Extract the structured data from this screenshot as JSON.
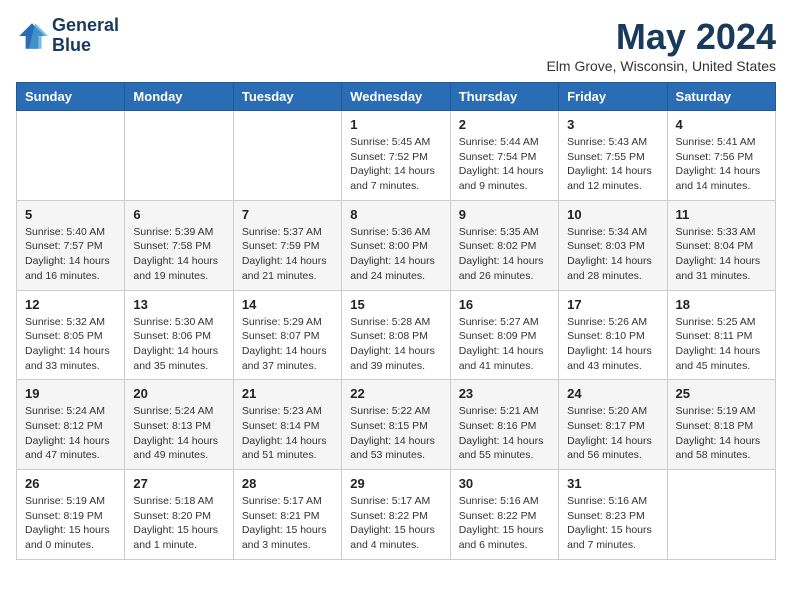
{
  "header": {
    "logo_line1": "General",
    "logo_line2": "Blue",
    "month_title": "May 2024",
    "location": "Elm Grove, Wisconsin, United States"
  },
  "days_of_week": [
    "Sunday",
    "Monday",
    "Tuesday",
    "Wednesday",
    "Thursday",
    "Friday",
    "Saturday"
  ],
  "weeks": [
    [
      {
        "day": "",
        "info": ""
      },
      {
        "day": "",
        "info": ""
      },
      {
        "day": "",
        "info": ""
      },
      {
        "day": "1",
        "info": "Sunrise: 5:45 AM\nSunset: 7:52 PM\nDaylight: 14 hours\nand 7 minutes."
      },
      {
        "day": "2",
        "info": "Sunrise: 5:44 AM\nSunset: 7:54 PM\nDaylight: 14 hours\nand 9 minutes."
      },
      {
        "day": "3",
        "info": "Sunrise: 5:43 AM\nSunset: 7:55 PM\nDaylight: 14 hours\nand 12 minutes."
      },
      {
        "day": "4",
        "info": "Sunrise: 5:41 AM\nSunset: 7:56 PM\nDaylight: 14 hours\nand 14 minutes."
      }
    ],
    [
      {
        "day": "5",
        "info": "Sunrise: 5:40 AM\nSunset: 7:57 PM\nDaylight: 14 hours\nand 16 minutes."
      },
      {
        "day": "6",
        "info": "Sunrise: 5:39 AM\nSunset: 7:58 PM\nDaylight: 14 hours\nand 19 minutes."
      },
      {
        "day": "7",
        "info": "Sunrise: 5:37 AM\nSunset: 7:59 PM\nDaylight: 14 hours\nand 21 minutes."
      },
      {
        "day": "8",
        "info": "Sunrise: 5:36 AM\nSunset: 8:00 PM\nDaylight: 14 hours\nand 24 minutes."
      },
      {
        "day": "9",
        "info": "Sunrise: 5:35 AM\nSunset: 8:02 PM\nDaylight: 14 hours\nand 26 minutes."
      },
      {
        "day": "10",
        "info": "Sunrise: 5:34 AM\nSunset: 8:03 PM\nDaylight: 14 hours\nand 28 minutes."
      },
      {
        "day": "11",
        "info": "Sunrise: 5:33 AM\nSunset: 8:04 PM\nDaylight: 14 hours\nand 31 minutes."
      }
    ],
    [
      {
        "day": "12",
        "info": "Sunrise: 5:32 AM\nSunset: 8:05 PM\nDaylight: 14 hours\nand 33 minutes."
      },
      {
        "day": "13",
        "info": "Sunrise: 5:30 AM\nSunset: 8:06 PM\nDaylight: 14 hours\nand 35 minutes."
      },
      {
        "day": "14",
        "info": "Sunrise: 5:29 AM\nSunset: 8:07 PM\nDaylight: 14 hours\nand 37 minutes."
      },
      {
        "day": "15",
        "info": "Sunrise: 5:28 AM\nSunset: 8:08 PM\nDaylight: 14 hours\nand 39 minutes."
      },
      {
        "day": "16",
        "info": "Sunrise: 5:27 AM\nSunset: 8:09 PM\nDaylight: 14 hours\nand 41 minutes."
      },
      {
        "day": "17",
        "info": "Sunrise: 5:26 AM\nSunset: 8:10 PM\nDaylight: 14 hours\nand 43 minutes."
      },
      {
        "day": "18",
        "info": "Sunrise: 5:25 AM\nSunset: 8:11 PM\nDaylight: 14 hours\nand 45 minutes."
      }
    ],
    [
      {
        "day": "19",
        "info": "Sunrise: 5:24 AM\nSunset: 8:12 PM\nDaylight: 14 hours\nand 47 minutes."
      },
      {
        "day": "20",
        "info": "Sunrise: 5:24 AM\nSunset: 8:13 PM\nDaylight: 14 hours\nand 49 minutes."
      },
      {
        "day": "21",
        "info": "Sunrise: 5:23 AM\nSunset: 8:14 PM\nDaylight: 14 hours\nand 51 minutes."
      },
      {
        "day": "22",
        "info": "Sunrise: 5:22 AM\nSunset: 8:15 PM\nDaylight: 14 hours\nand 53 minutes."
      },
      {
        "day": "23",
        "info": "Sunrise: 5:21 AM\nSunset: 8:16 PM\nDaylight: 14 hours\nand 55 minutes."
      },
      {
        "day": "24",
        "info": "Sunrise: 5:20 AM\nSunset: 8:17 PM\nDaylight: 14 hours\nand 56 minutes."
      },
      {
        "day": "25",
        "info": "Sunrise: 5:19 AM\nSunset: 8:18 PM\nDaylight: 14 hours\nand 58 minutes."
      }
    ],
    [
      {
        "day": "26",
        "info": "Sunrise: 5:19 AM\nSunset: 8:19 PM\nDaylight: 15 hours\nand 0 minutes."
      },
      {
        "day": "27",
        "info": "Sunrise: 5:18 AM\nSunset: 8:20 PM\nDaylight: 15 hours\nand 1 minute."
      },
      {
        "day": "28",
        "info": "Sunrise: 5:17 AM\nSunset: 8:21 PM\nDaylight: 15 hours\nand 3 minutes."
      },
      {
        "day": "29",
        "info": "Sunrise: 5:17 AM\nSunset: 8:22 PM\nDaylight: 15 hours\nand 4 minutes."
      },
      {
        "day": "30",
        "info": "Sunrise: 5:16 AM\nSunset: 8:22 PM\nDaylight: 15 hours\nand 6 minutes."
      },
      {
        "day": "31",
        "info": "Sunrise: 5:16 AM\nSunset: 8:23 PM\nDaylight: 15 hours\nand 7 minutes."
      },
      {
        "day": "",
        "info": ""
      }
    ]
  ]
}
